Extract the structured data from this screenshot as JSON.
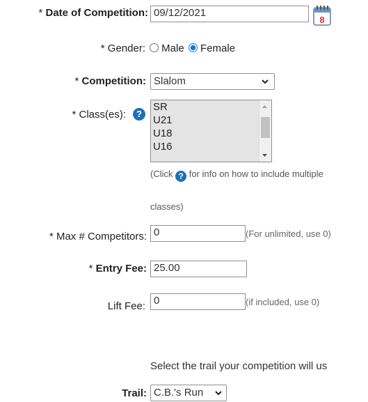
{
  "date": {
    "label": "Date of Competition:",
    "value": "09/12/2021",
    "calendar_day": "8"
  },
  "gender": {
    "label": "Gender:",
    "options": [
      "Male",
      "Female"
    ],
    "selected": "Female"
  },
  "competition": {
    "label": "Competition:",
    "value": "Slalom"
  },
  "classes": {
    "label": "Class(es):",
    "items": [
      "SR",
      "U21",
      "U18",
      "U16"
    ],
    "note_before": "(Click",
    "note_after": "for info on how to include multiple",
    "note_line2": "classes)"
  },
  "max_competitors": {
    "label": "Max # Competitors:",
    "value": "0",
    "hint": "(For unlimited, use 0)"
  },
  "entry_fee": {
    "label": "Entry Fee:",
    "value": "25.00"
  },
  "lift_fee": {
    "label": "Lift Fee:",
    "value": "0",
    "hint": "(if included, use 0)"
  },
  "trail_prompt": "Select the trail your competition will us",
  "trail": {
    "label": "Trail:",
    "value": "C.B.'s Run"
  },
  "required_marker": "*",
  "help_icon_glyph": "?",
  "colors": {
    "help_icon": "#1f6fb8",
    "radio_checked": "#1a73e8",
    "calendar_red": "#d9342b"
  }
}
